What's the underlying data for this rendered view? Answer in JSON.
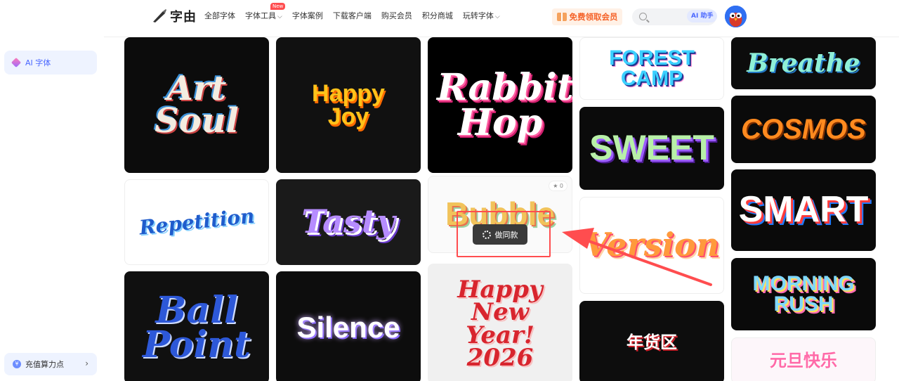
{
  "header": {
    "logo_text": "字由",
    "nav": [
      "全部字体",
      "字体工具",
      "字体案例",
      "下载客户端",
      "购买会员",
      "积分商城",
      "玩转字体"
    ],
    "nav_new_badge": "New",
    "vip_cta": "免费领取会员",
    "ai_helper": "AI 助手"
  },
  "sidebar": {
    "ai_font": "AI 字体",
    "recharge": "充值算力点"
  },
  "cards": {
    "art_soul": "Art Soul",
    "happy_joy": "Happy Joy",
    "rabbit_hop": "Rabbit Hop",
    "forest_camp": "FOREST CAMP",
    "breathe": "Breathe",
    "cosmos": "COSMOS",
    "sweet": "SWEET",
    "repetition": "Repetition",
    "tasty": "Tasty",
    "bubble": "Bubble",
    "bubble_likes": "0",
    "version": "Version",
    "smart": "SMART",
    "morning_rush": "MORNING RUSH",
    "ball_point": "Ball Point",
    "silence": "Silence",
    "new_year": "Happy New Year! 2026",
    "nianhuo": "年货区",
    "yuandan": "元旦快乐"
  },
  "overlay": {
    "make_same": "做同款"
  },
  "colors": {
    "accent_blue": "#4a67ff",
    "highlight_red": "#ff4d4f",
    "vip_orange": "#f5642a"
  }
}
